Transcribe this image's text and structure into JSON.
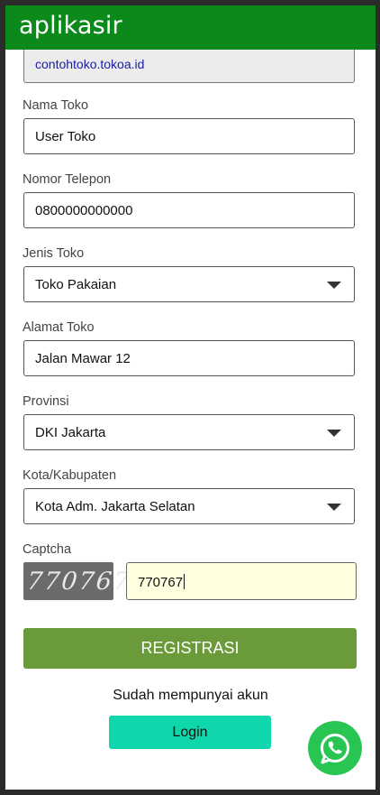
{
  "app": {
    "logo": "aplikasir"
  },
  "store_url": {
    "value": "contohtoko.tokoa.id"
  },
  "form": {
    "store_name": {
      "label": "Nama Toko",
      "value": "User Toko"
    },
    "phone": {
      "label": "Nomor Telepon",
      "value": "0800000000000"
    },
    "store_type": {
      "label": "Jenis Toko",
      "value": "Toko Pakaian"
    },
    "address": {
      "label": "Alamat Toko",
      "value": "Jalan Mawar 12"
    },
    "province": {
      "label": "Provinsi",
      "value": "DKI Jakarta"
    },
    "city": {
      "label": "Kota/Kabupaten",
      "value": "Kota Adm. Jakarta Selatan"
    },
    "captcha": {
      "label": "Captcha",
      "image_text": "770767",
      "value": "770767"
    }
  },
  "actions": {
    "register_label": "REGISTRASI",
    "have_account_text": "Sudah mempunyai akun",
    "login_label": "Login"
  },
  "colors": {
    "header": "#0b8a1b",
    "register_button": "#6a9a3a",
    "login_button": "#10d6ac",
    "whatsapp": "#28c553"
  },
  "icons": {
    "whatsapp": "whatsapp-icon",
    "dropdown": "chevron-down-icon"
  }
}
